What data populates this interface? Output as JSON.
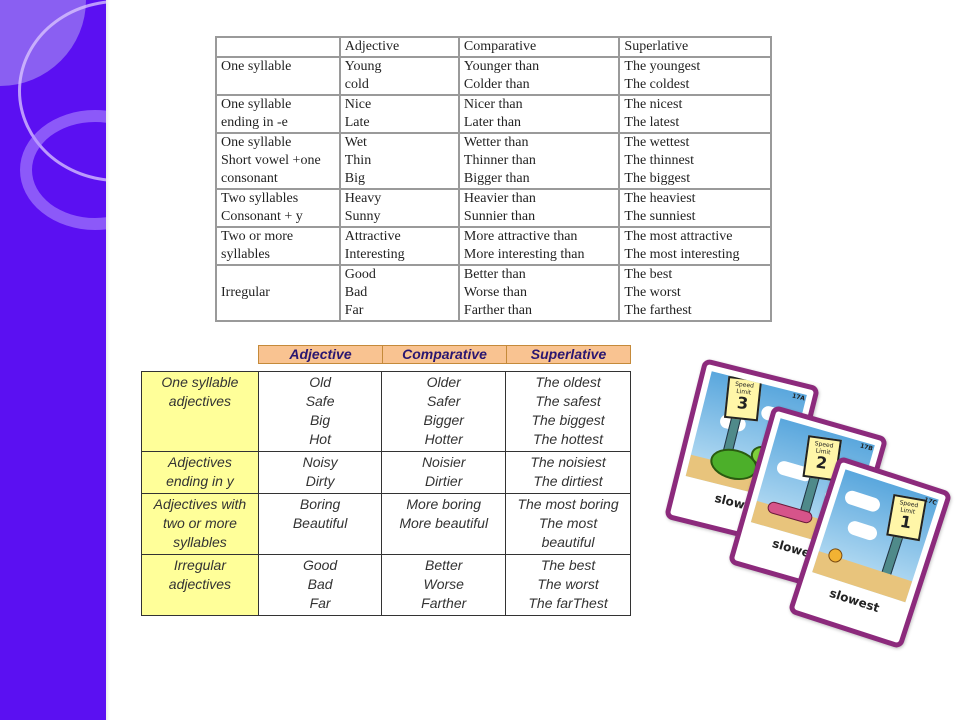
{
  "slide": {
    "accent_color": "#5b10f2",
    "header_fill_color": "#f9c391",
    "category_fill_color": "#ffff99"
  },
  "table1": {
    "headers": [
      "",
      "Adjective",
      "Comparative",
      "Superlative"
    ],
    "rows": [
      {
        "category": [
          "One syllable"
        ],
        "adjective": [
          "Young",
          "cold"
        ],
        "comparative": [
          "Younger than",
          "Colder than"
        ],
        "superlative": [
          "The youngest",
          "The coldest"
        ]
      },
      {
        "category": [
          "One syllable",
          "ending in   -e"
        ],
        "adjective": [
          "Nice",
          "Late"
        ],
        "comparative": [
          "Nicer than",
          "Later than"
        ],
        "superlative": [
          "The nicest",
          "The latest"
        ]
      },
      {
        "category": [
          "One syllable",
          "Short vowel +one",
          "consonant"
        ],
        "adjective": [
          "Wet",
          "Thin",
          "Big"
        ],
        "comparative": [
          "Wetter than",
          "Thinner than",
          "Bigger than"
        ],
        "superlative": [
          "The wettest",
          "The thinnest",
          "The biggest"
        ]
      },
      {
        "category": [
          "Two syllables",
          "Consonant + y"
        ],
        "adjective": [
          "Heavy",
          "Sunny"
        ],
        "comparative": [
          "Heavier than",
          "Sunnier than"
        ],
        "superlative": [
          "The heaviest",
          "The sunniest"
        ]
      },
      {
        "category": [
          "Two or more",
          "syllables"
        ],
        "adjective": [
          "Attractive",
          "Interesting"
        ],
        "comparative": [
          "More attractive than",
          "More interesting than"
        ],
        "superlative": [
          "The most attractive",
          "The most interesting"
        ]
      },
      {
        "category": [
          "Irregular"
        ],
        "adjective": [
          "Good",
          "Bad",
          "Far"
        ],
        "comparative": [
          "Better than",
          "Worse than",
          "Farther than"
        ],
        "superlative": [
          "The best",
          "The worst",
          "The farthest"
        ]
      }
    ]
  },
  "table2": {
    "headers": [
      "Adjective",
      "Comparative",
      "Superlative"
    ],
    "rows": [
      {
        "category": [
          "One syllable",
          "adjectives"
        ],
        "adjective": [
          "Old",
          "Safe",
          "Big",
          "Hot"
        ],
        "comparative": [
          "Older",
          "Safer",
          "Bigger",
          "Hotter"
        ],
        "superlative": [
          "The oldest",
          "The safest",
          "The biggest",
          "The hottest"
        ]
      },
      {
        "category": [
          "Adjectives",
          "ending in y"
        ],
        "adjective": [
          "Noisy",
          "Dirty"
        ],
        "comparative": [
          "Noisier",
          "Dirtier"
        ],
        "superlative": [
          "The noisiest",
          "The dirtiest"
        ]
      },
      {
        "category": [
          "Adjectives with",
          "two or more",
          "syllables"
        ],
        "adjective": [
          "Boring",
          "Beautiful"
        ],
        "comparative": [
          "More boring",
          "More beautiful"
        ],
        "superlative": [
          "The most boring",
          "The most",
          "beautiful"
        ]
      },
      {
        "category": [
          "Irregular",
          "adjectives"
        ],
        "adjective": [
          "Good",
          "Bad",
          "Far"
        ],
        "comparative": [
          "Better",
          "Worse",
          "Farther"
        ],
        "superlative": [
          "The best",
          "The worst",
          "The farThest"
        ]
      }
    ]
  },
  "cards": [
    {
      "code": "17A",
      "sign_label": "Speed Limit",
      "sign_number": "3",
      "word": "slow",
      "animal": "turtle"
    },
    {
      "code": "17B",
      "sign_label": "Speed Limit",
      "sign_number": "2",
      "word": "slower",
      "animal": "caterpillar"
    },
    {
      "code": "17C",
      "sign_label": "Speed Limit",
      "sign_number": "1",
      "word": "slowest",
      "animal": "snail"
    }
  ]
}
